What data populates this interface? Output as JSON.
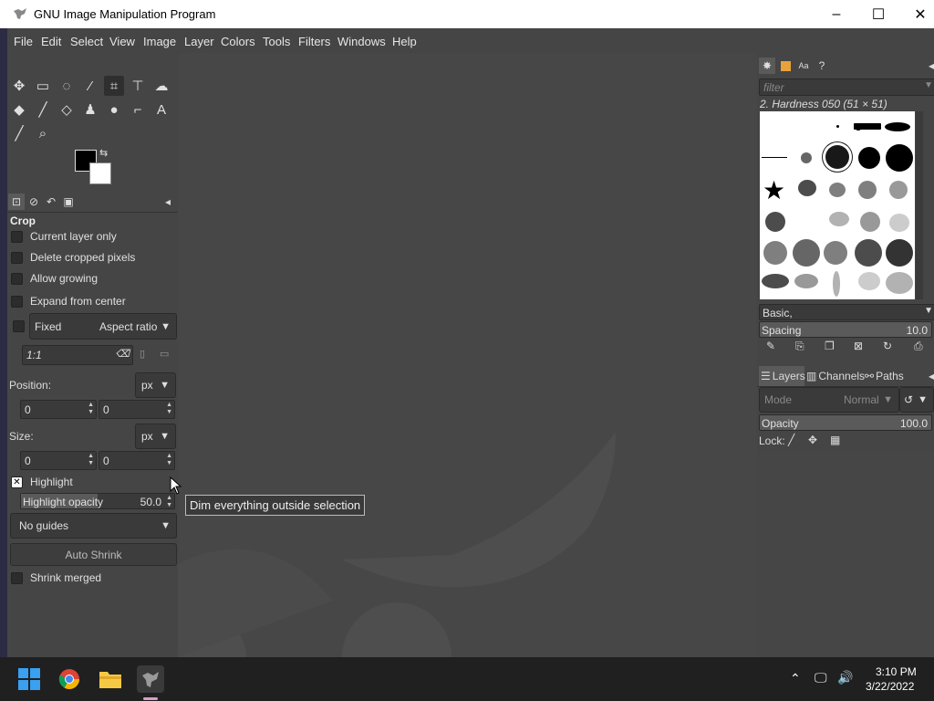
{
  "window": {
    "title": "GNU Image Manipulation Program",
    "controls": [
      "–",
      "☐",
      "✕"
    ]
  },
  "menubar": [
    "File",
    "Edit",
    "Select",
    "View",
    "Image",
    "Layer",
    "Colors",
    "Tools",
    "Filters",
    "Windows",
    "Help"
  ],
  "tools": [
    "move-icon",
    "rect-select-icon",
    "lasso-icon",
    "fuzzy-select-icon",
    "crop-icon",
    "transform-icon",
    "warp-icon",
    "bucket-fill-icon",
    "paintbrush-icon",
    "eraser-icon",
    "clone-icon",
    "smudge-icon",
    "paths-icon",
    "text-icon",
    "color-picker-icon",
    "zoom-icon"
  ],
  "tool_options": {
    "title": "Crop",
    "current_layer_only": "Current layer only",
    "delete_cropped": "Delete cropped pixels",
    "allow_growing": "Allow growing",
    "expand_from_center": "Expand from center",
    "fixed": "Fixed",
    "aspect_ratio": "Aspect ratio",
    "ratio_value": "1:1",
    "position_label": "Position:",
    "position_unit": "px",
    "pos_x": "0",
    "pos_y": "0",
    "size_label": "Size:",
    "size_unit": "px",
    "size_w": "0",
    "size_h": "0",
    "highlight": "Highlight",
    "highlight_opacity_label": "Highlight opacity",
    "highlight_opacity_value": "50.0",
    "highlight_opacity_fraction": 0.5,
    "guides": "No guides",
    "auto_shrink": "Auto Shrink",
    "shrink_merged": "Shrink merged"
  },
  "tooltip": "Dim everything outside selection",
  "brushes": {
    "filter_placeholder": "filter",
    "selected_brush": "2. Hardness 050 (51 × 51)",
    "tag": "Basic,",
    "spacing_label": "Spacing",
    "spacing_value": "10.0"
  },
  "layers": {
    "tabs": [
      "Layers",
      "Channels",
      "Paths"
    ],
    "mode_label": "Mode",
    "mode_value": "Normal",
    "opacity_label": "Opacity",
    "opacity_value": "100.0",
    "lock_label": "Lock:"
  },
  "taskbar": {
    "time": "3:10 PM",
    "date": "3/22/2022"
  },
  "colors": {
    "accent_taskbar": "#202020",
    "panel": "#454545"
  }
}
